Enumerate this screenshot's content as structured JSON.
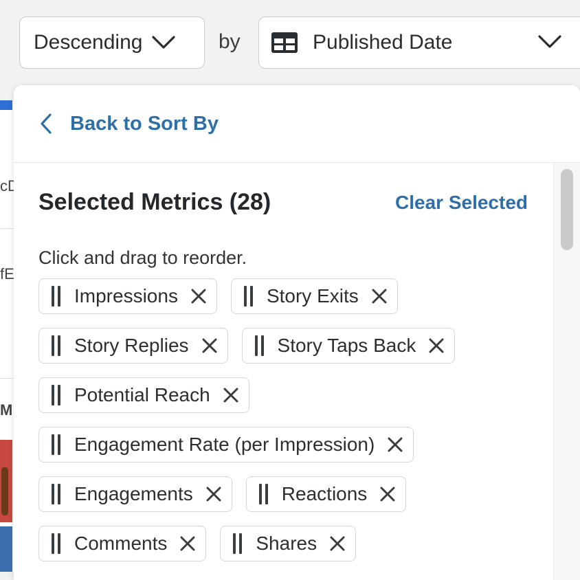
{
  "sort": {
    "order_value": "Descending",
    "by_label": "by",
    "field_value": "Published Date",
    "field_icon": "table-icon"
  },
  "background": {
    "row1_fragment": "cD",
    "row2_fragment": "fE",
    "row3_fragment": "M"
  },
  "panel": {
    "back_label": "Back to Sort By",
    "heading": "Selected Metrics (28)",
    "clear_label": "Clear Selected",
    "hint": "Click and drag to reorder.",
    "chips": [
      {
        "label": "Impressions"
      },
      {
        "label": "Story Exits"
      },
      {
        "label": "Story Replies"
      },
      {
        "label": "Story Taps Back"
      },
      {
        "label": "Potential Reach"
      },
      {
        "label": "Engagement Rate (per Impression)"
      },
      {
        "label": "Engagements"
      },
      {
        "label": "Reactions"
      },
      {
        "label": "Comments"
      },
      {
        "label": "Shares"
      }
    ]
  },
  "colors": {
    "link": "#2f6fa8",
    "accent_blue": "#2f6fd6"
  }
}
